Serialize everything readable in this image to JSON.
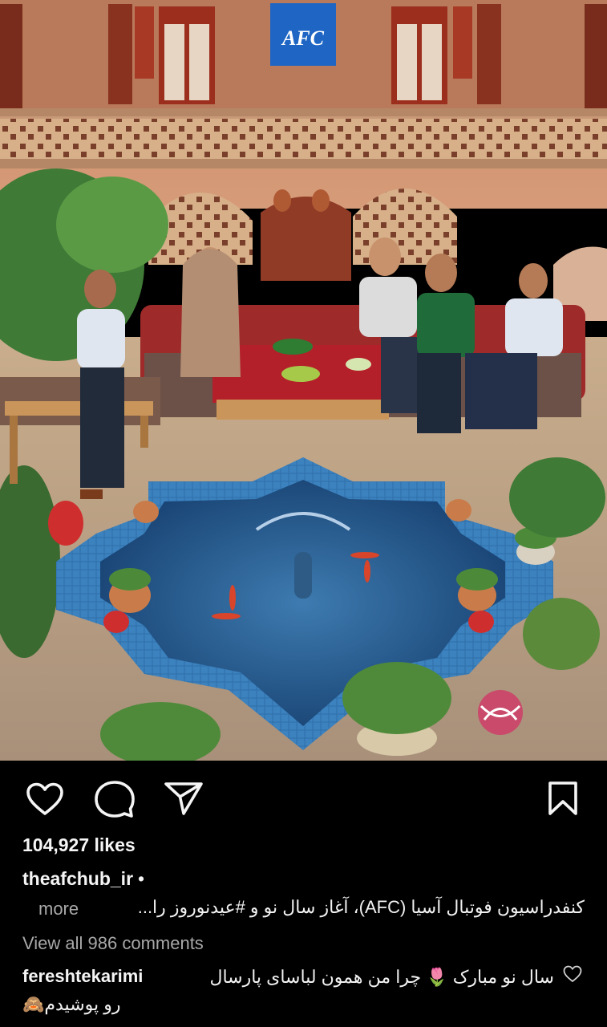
{
  "post": {
    "image": {
      "logo_text": "AFC",
      "description_icon": "courtyard-illustration"
    },
    "actions": {
      "like_icon": "heart-icon",
      "comment_icon": "comment-bubble-icon",
      "share_icon": "send-icon",
      "save_icon": "bookmark-icon"
    },
    "likes": "104,927 likes",
    "caption": {
      "username": "theafchub_ir",
      "separator": "•",
      "text": "کنفدراسیون فوتبال آسیا (AFC)، آغاز سال نو و #عیدنوروز را...",
      "more_label": "more"
    },
    "view_comments": "View all 986 comments",
    "comment": {
      "username": "fereshtekarimi",
      "line1": "سال نو مبارک 🌷 چرا من همون لباسای پارسال",
      "line2": "رو پوشیدم🙈",
      "like_icon": "small-heart-icon"
    }
  },
  "colors": {
    "background": "#000000",
    "text": "#f5f5f5",
    "muted": "#a8a8a8",
    "afc_blue": "#1f66c4"
  }
}
